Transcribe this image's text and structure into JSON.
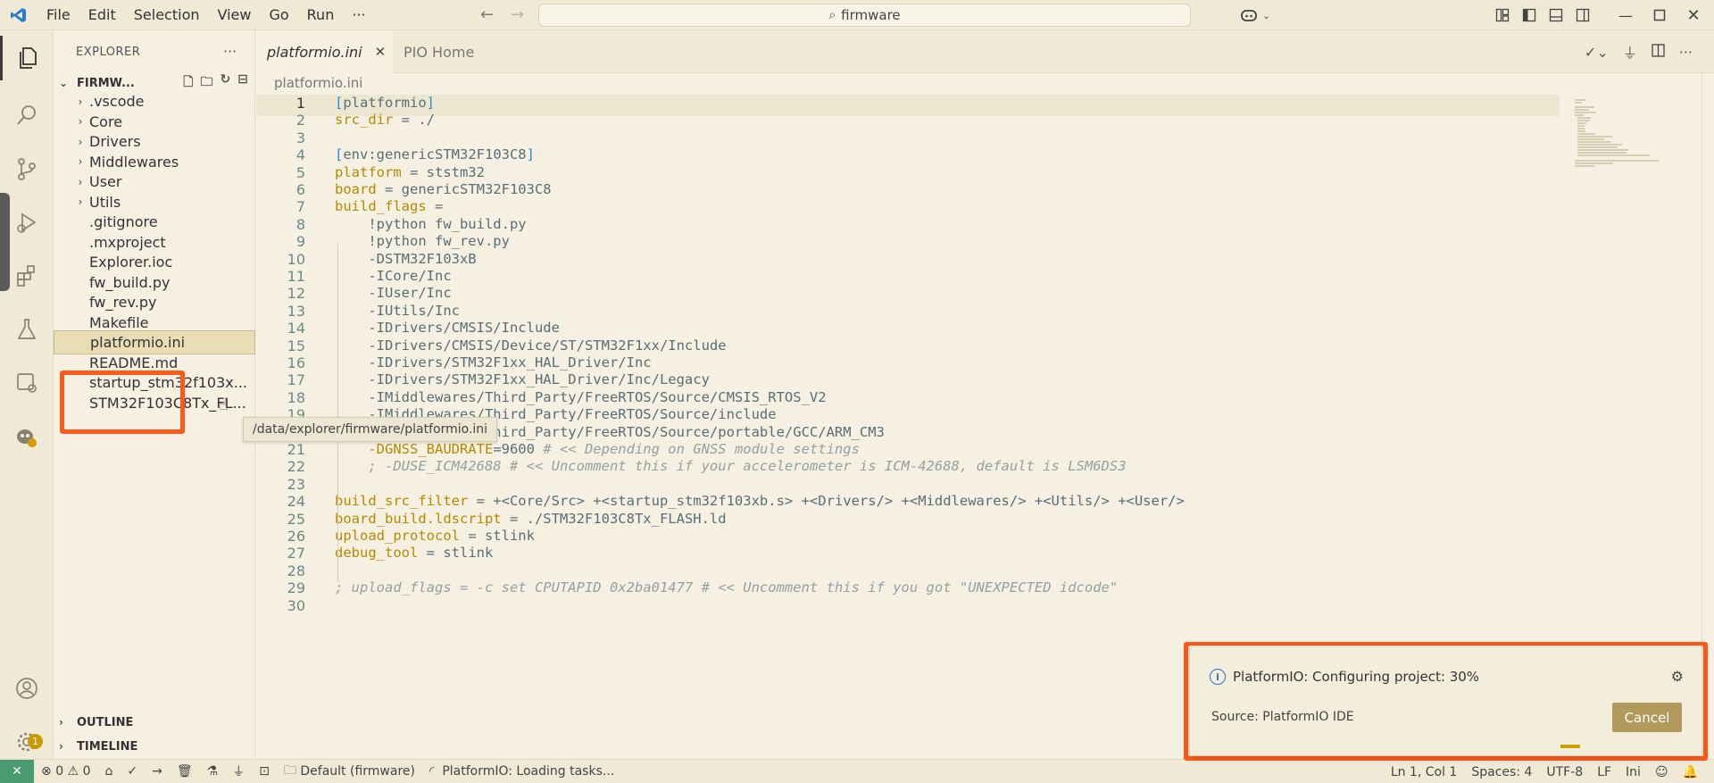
{
  "titlebar": {
    "menus": [
      "File",
      "Edit",
      "Selection",
      "View",
      "Go",
      "Run",
      "···"
    ],
    "search_text": "firmware"
  },
  "explorer": {
    "header": "EXPLORER",
    "more": "···",
    "root_label": "FIRMW...",
    "items": [
      {
        "label": ".vscode",
        "folder": true
      },
      {
        "label": "Core",
        "folder": true
      },
      {
        "label": "Drivers",
        "folder": true
      },
      {
        "label": "Middlewares",
        "folder": true
      },
      {
        "label": "User",
        "folder": true
      },
      {
        "label": "Utils",
        "folder": true
      },
      {
        "label": ".gitignore",
        "folder": false
      },
      {
        "label": ".mxproject",
        "folder": false
      },
      {
        "label": "Explorer.ioc",
        "folder": false
      },
      {
        "label": "fw_build.py",
        "folder": false
      },
      {
        "label": "fw_rev.py",
        "folder": false
      },
      {
        "label": "Makefile",
        "folder": false
      },
      {
        "label": "platformio.ini",
        "folder": false,
        "selected": true
      },
      {
        "label": "README.md",
        "folder": false
      },
      {
        "label": "startup_stm32f103x...",
        "folder": false
      },
      {
        "label": "STM32F103C8Tx_FL...",
        "folder": false
      }
    ],
    "tooltip": "/data/explorer/firmware/platformio.ini",
    "outline_label": "OUTLINE",
    "timeline_label": "TIMELINE"
  },
  "tabs": [
    {
      "label": "platformio.ini",
      "active": true
    },
    {
      "label": "PIO Home",
      "active": false
    }
  ],
  "breadcrumb": "platformio.ini",
  "code_lines": [
    "[platformio]",
    "src_dir = ./",
    "",
    "[env:genericSTM32F103C8]",
    "platform = ststm32",
    "board = genericSTM32F103C8",
    "build_flags =",
    "    !python fw_build.py",
    "    !python fw_rev.py",
    "    -DSTM32F103xB",
    "    -ICore/Inc",
    "    -IUser/Inc",
    "    -IUtils/Inc",
    "    -IDrivers/CMSIS/Include",
    "    -IDrivers/CMSIS/Device/ST/STM32F1xx/Include",
    "    -IDrivers/STM32F1xx_HAL_Driver/Inc",
    "    -IDrivers/STM32F1xx_HAL_Driver/Inc/Legacy",
    "    -IMiddlewares/Third_Party/FreeRTOS/Source/CMSIS_RTOS_V2",
    "    -IMiddlewares/Third_Party/FreeRTOS/Source/include",
    "    -IMiddlewares/Third_Party/FreeRTOS/Source/portable/GCC/ARM_CM3",
    "    -DGNSS_BAUDRATE=9600 # << Depending on GNSS module settings",
    "    ; -DUSE_ICM42688 # << Uncomment this if your accelerometer is ICM-42688, default is LSM6DS3",
    "",
    "build_src_filter = +<Core/Src> +<startup_stm32f103xb.s> +<Drivers/> +<Middlewares/> +<Utils/> +<User/>",
    "board_build.ldscript = ./STM32F103C8Tx_FLASH.ld",
    "upload_protocol = stlink",
    "debug_tool = stlink",
    "",
    "; upload_flags = -c set CPUTAPID 0x2ba01477 # << Uncomment this if you got \"UNEXPECTED idcode\"",
    ""
  ],
  "notification": {
    "message": "PlatformIO: Configuring project: 30%",
    "source": "Source: PlatformIO IDE",
    "cancel_label": "Cancel",
    "progress_percent": 30
  },
  "statusbar": {
    "errors": "0",
    "warnings": "0",
    "env": "Default (firmware)",
    "tasks": "PlatformIO: Loading tasks...",
    "position": "Ln 1, Col 1",
    "spaces": "Spaces: 4",
    "encoding": "UTF-8",
    "eol": "LF",
    "language": "Ini"
  },
  "colors": {
    "highlight": "#ff5a1a",
    "background": "#f5f0e1",
    "keyword": "#b58900",
    "section": "#268bd2",
    "comment": "#93a1a1"
  }
}
